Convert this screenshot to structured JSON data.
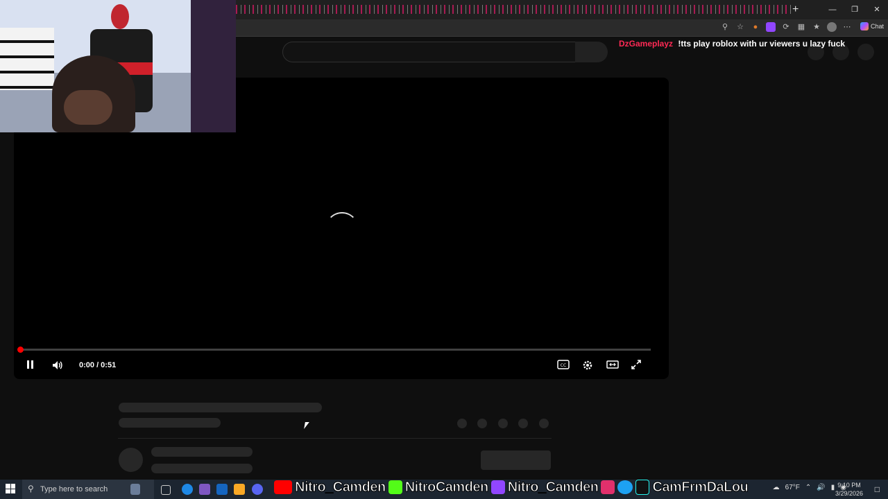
{
  "browser": {
    "new_tab_icon": "plus-icon",
    "window_controls": [
      "minimize-icon",
      "restore-icon",
      "close-icon"
    ],
    "toolbar_icons": [
      "zoom-icon",
      "star-icon",
      "extension-icon",
      "twitch-icon",
      "refresh-icon",
      "puzzle-icon",
      "favorites-icon",
      "profile-icon",
      "more-icon"
    ],
    "copilot_label": "Chat"
  },
  "stream_chat": {
    "username": "DzGameplayz",
    "message": "!tts play roblox with ur viewers u lazy fuck",
    "username_color": "#ff2a55"
  },
  "player": {
    "time_display": "0:00 / 0:51",
    "progress_fraction": 0.0,
    "state": "loading",
    "controls": [
      "pause-icon",
      "volume-icon",
      "captions-icon",
      "settings-icon",
      "theater-icon",
      "fullscreen-icon"
    ]
  },
  "taskbar": {
    "search_placeholder": "Type here to search",
    "weather": "67°F",
    "time": "9:10 PM",
    "date": "3/29/2026"
  },
  "overlay_socials": [
    {
      "platform": "youtube",
      "name": "Nitro_Camden",
      "color": "#ff0000"
    },
    {
      "platform": "kick",
      "name": "NitroCamden",
      "color": "#53fc18"
    },
    {
      "platform": "twitch",
      "name": "Nitro_Camden",
      "color": "#9146ff"
    },
    {
      "platform": "instagram",
      "name": "",
      "color": "#e1306c"
    },
    {
      "platform": "twitter",
      "name": "",
      "color": "#1da1f2"
    },
    {
      "platform": "tiktok",
      "name": "CamFrmDaLou",
      "color": "#111111"
    }
  ]
}
